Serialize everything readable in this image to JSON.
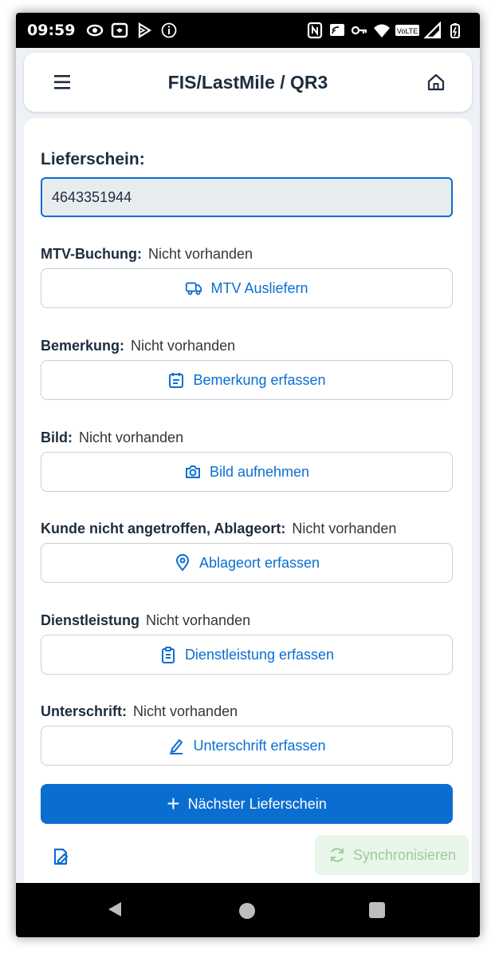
{
  "statusbar": {
    "time": "09:59",
    "icons_left": [
      "eye-icon",
      "cast-icon",
      "play-icon",
      "info-icon"
    ],
    "icons_right": [
      "nfc-icon",
      "screencast-icon",
      "vpn-key-icon",
      "wifi-icon",
      "volte-icon",
      "signal-icon",
      "battery-icon"
    ],
    "volte_label": "VoLTE"
  },
  "header": {
    "title": "FIS/LastMile / QR3",
    "menu_icon": "hamburger-icon",
    "home_icon": "home-icon"
  },
  "lieferschein": {
    "label": "Lieferschein:",
    "value": "4643351944"
  },
  "rows": [
    {
      "label": "MTV-Buchung:",
      "status": "Nicht vorhanden",
      "button": "MTV Ausliefern",
      "icon": "truck-icon"
    },
    {
      "label": "Bemerkung:",
      "status": "Nicht vorhanden",
      "button": "Bemerkung erfassen",
      "icon": "calendar-note-icon"
    },
    {
      "label": "Bild:",
      "status": "Nicht vorhanden",
      "button": "Bild aufnehmen",
      "icon": "camera-icon"
    },
    {
      "label": "Kunde nicht angetroffen, Ablageort:",
      "status": "Nicht vorhanden",
      "button": "Ablageort erfassen",
      "icon": "location-pin-icon"
    },
    {
      "label": "Dienstleistung",
      "status": "Nicht vorhanden",
      "button": "Dienstleistung erfassen",
      "icon": "clipboard-icon"
    },
    {
      "label": "Unterschrift:",
      "status": "Nicht vorhanden",
      "button": "Unterschrift erfassen",
      "icon": "pen-signature-icon"
    }
  ],
  "primary_button": {
    "label": "Nächster Lieferschein",
    "icon": "plus-icon"
  },
  "footer": {
    "edit_icon": "edit-document-icon",
    "sync_label": "Synchronisieren",
    "sync_icon": "sync-icon"
  },
  "colors": {
    "accent": "#0a6ed1",
    "text": "#1d2d3e",
    "sync_bg": "#e8f5e9",
    "sync_text": "#9ccc9c"
  }
}
